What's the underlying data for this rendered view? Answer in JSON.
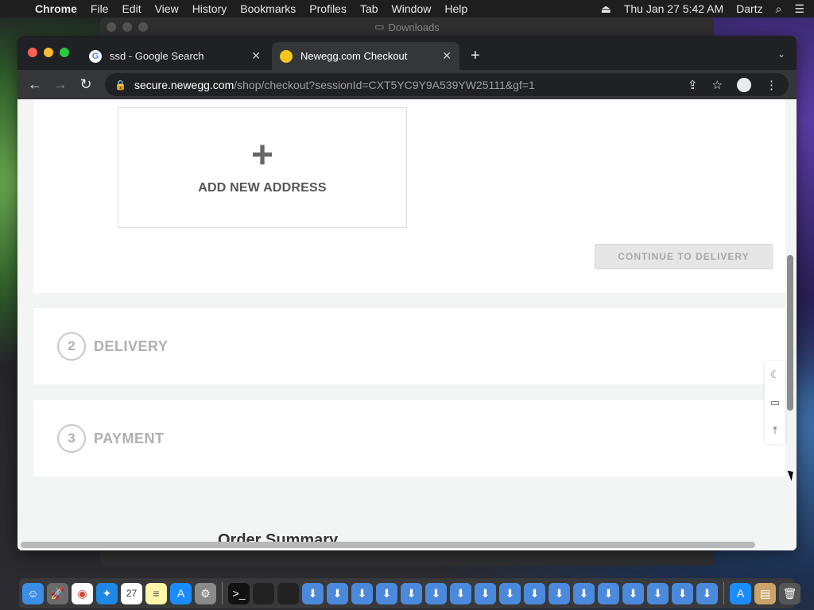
{
  "menubar": {
    "app": "Chrome",
    "menus": [
      "File",
      "Edit",
      "View",
      "History",
      "Bookmarks",
      "Profiles",
      "Tab",
      "Window",
      "Help"
    ],
    "datetime": "Thu Jan 27  5:42 AM",
    "user": "Dartz"
  },
  "background_window": {
    "title": "Downloads"
  },
  "browser": {
    "tabs": [
      {
        "title": "ssd - Google Search",
        "favicon": "google-icon",
        "active": false
      },
      {
        "title": "Newegg.com Checkout",
        "favicon": "newegg-icon",
        "active": true
      }
    ],
    "url_host": "secure.newegg.com",
    "url_path": "/shop/checkout?sessionId=CXT5YC9Y9A539YW25111&gf=1"
  },
  "checkout": {
    "add_address_label": "ADD NEW ADDRESS",
    "continue_button": "CONTINUE TO DELIVERY",
    "steps": [
      {
        "number": "2",
        "title": "DELIVERY"
      },
      {
        "number": "3",
        "title": "PAYMENT"
      }
    ],
    "order_summary_title": "Order Summary"
  },
  "side_tools": [
    "moon-icon",
    "feedback-icon",
    "back-to-top-icon"
  ],
  "dock": {
    "apps": [
      "finder",
      "launchpad",
      "chrome",
      "safari",
      "calendar",
      "notes",
      "app-store",
      "system-preferences",
      "terminal",
      "terminal",
      "terminal"
    ],
    "calendar_day": "27",
    "installer_count": 17
  },
  "colors": {
    "menubar_bg": "#1e1e1e",
    "tab_active_bg": "#35363a",
    "page_bg": "#f3f4f4",
    "muted_text": "#b0b0b0"
  }
}
